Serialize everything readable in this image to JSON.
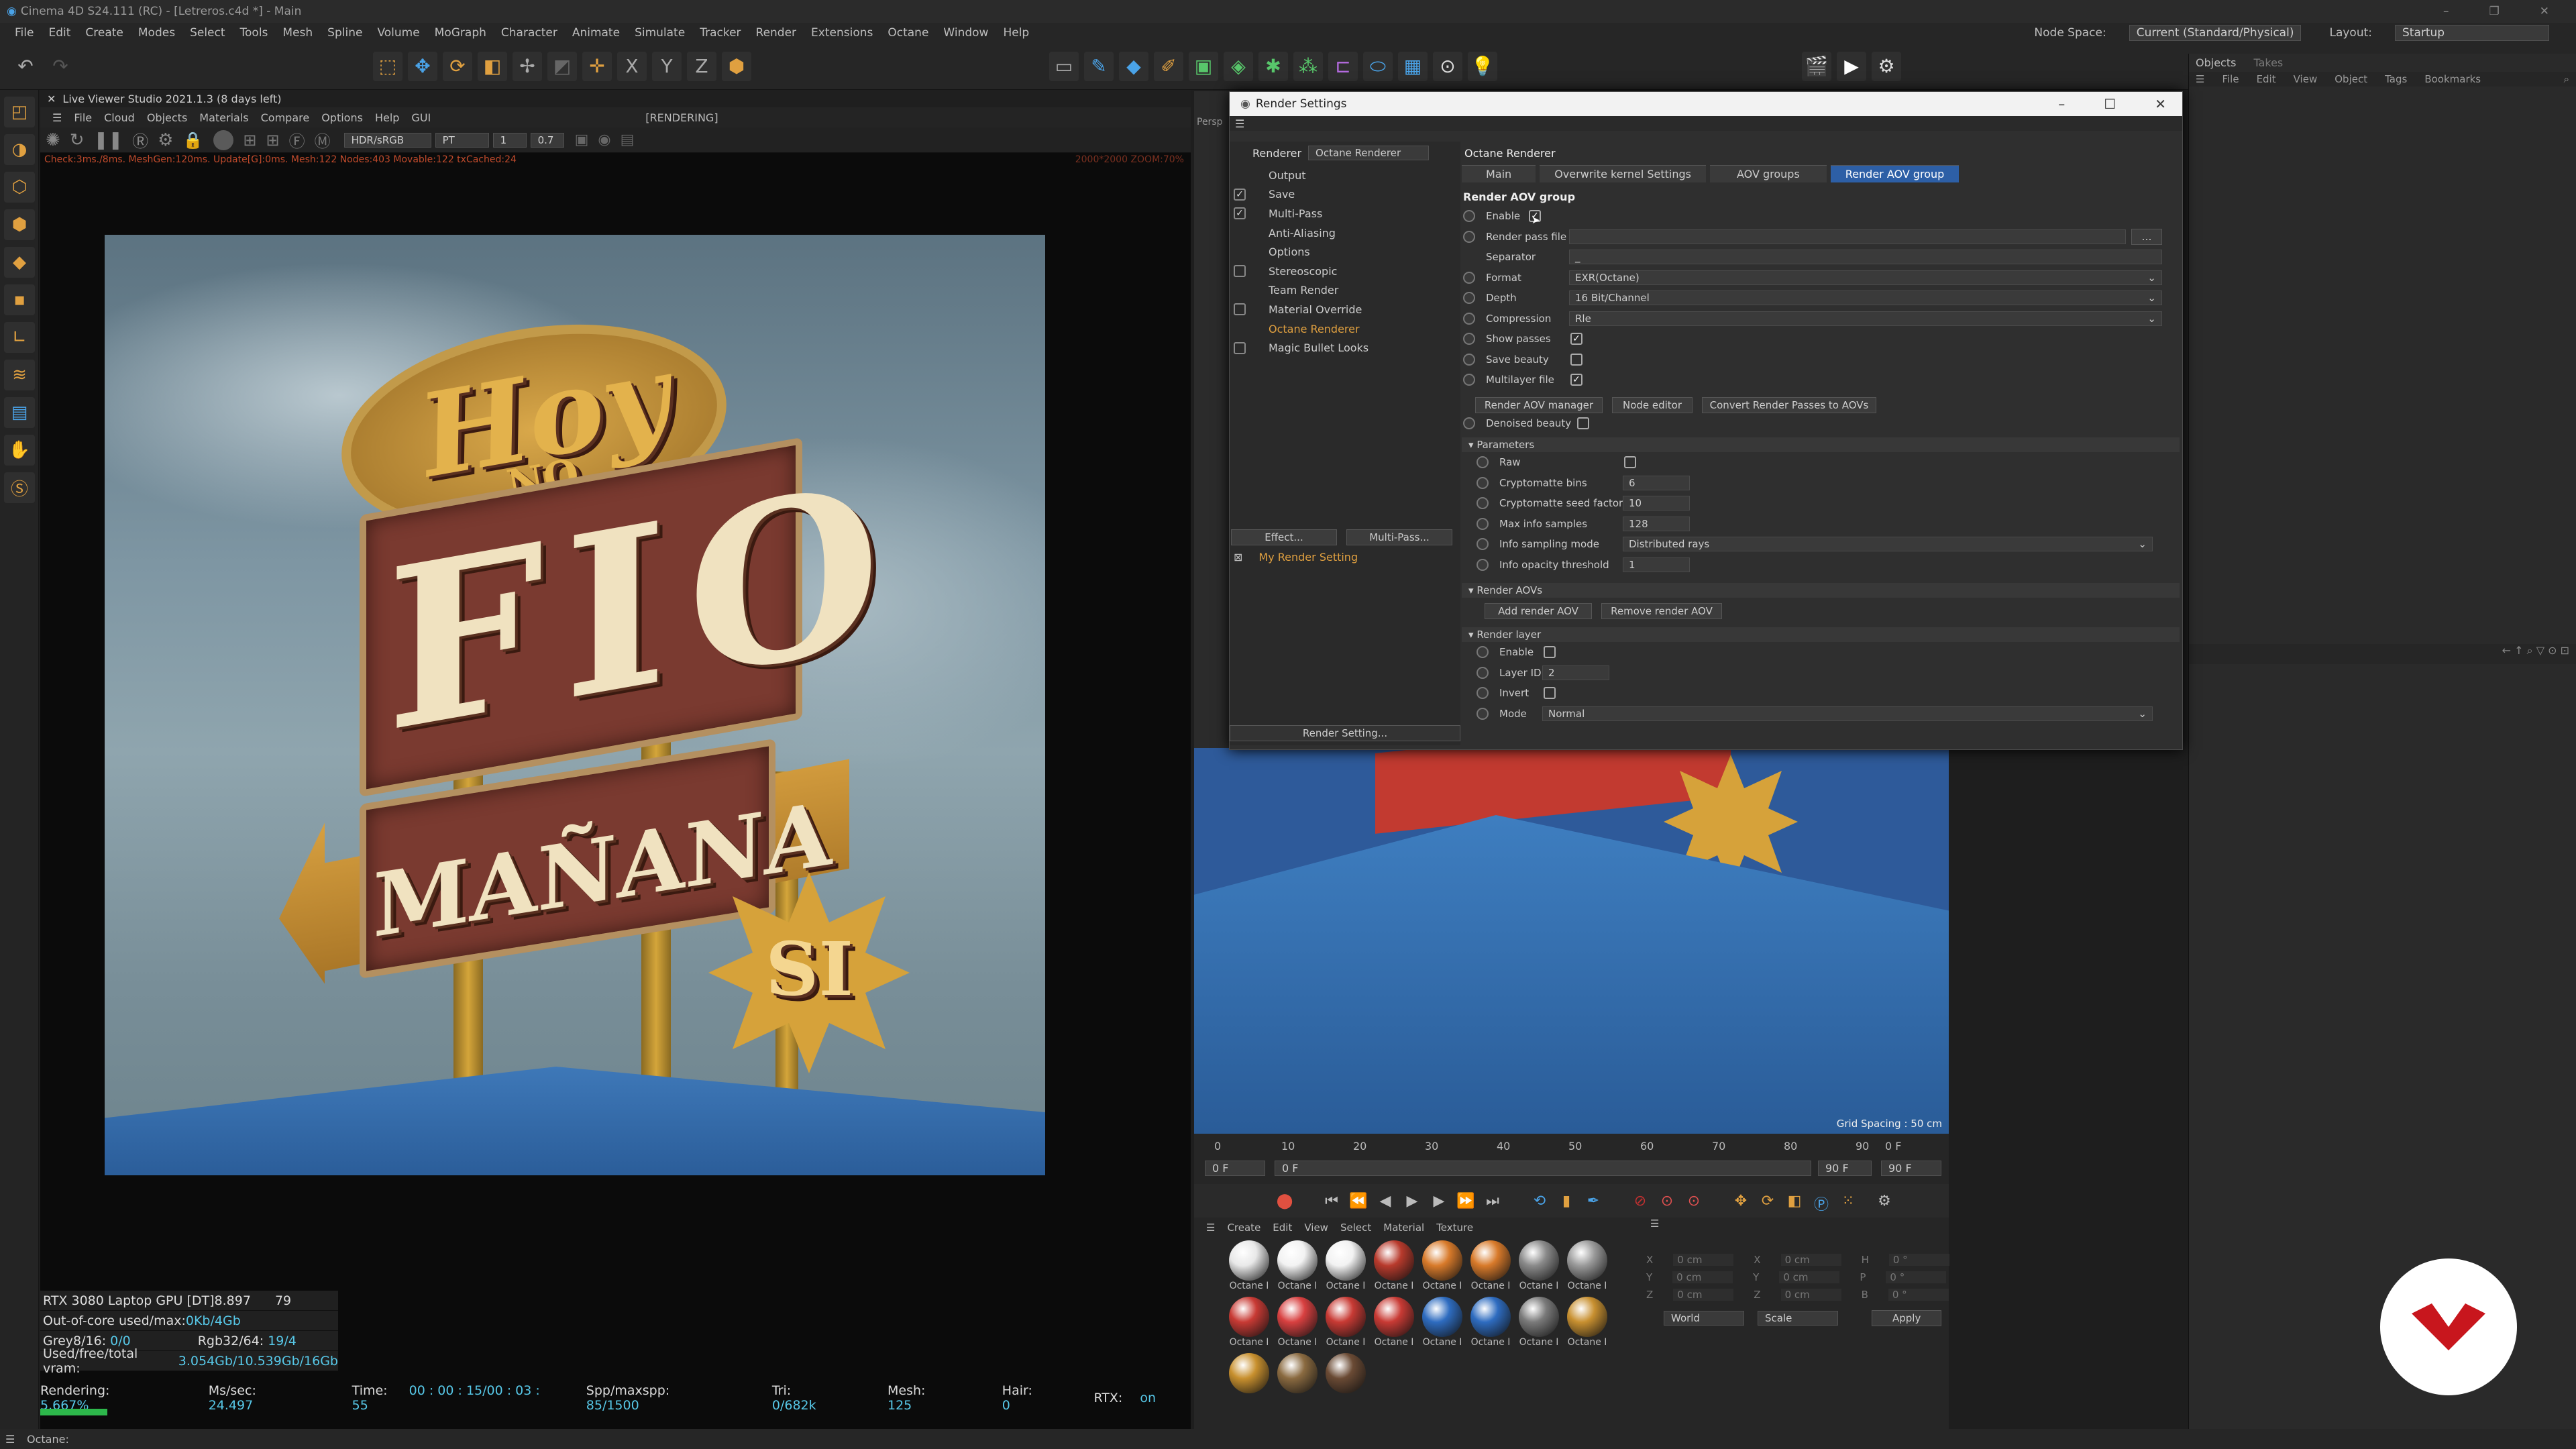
{
  "window": {
    "title": "Cinema 4D S24.111 (RC) - [Letreros.c4d *] - Main"
  },
  "menus": [
    "File",
    "Edit",
    "Create",
    "Modes",
    "Select",
    "Tools",
    "Mesh",
    "Spline",
    "Volume",
    "MoGraph",
    "Character",
    "Animate",
    "Simulate",
    "Tracker",
    "Render",
    "Extensions",
    "Octane",
    "Window",
    "Help"
  ],
  "node_space": {
    "label": "Node Space:",
    "value": "Current (Standard/Physical)"
  },
  "layout": {
    "label": "Layout:",
    "value": "Startup"
  },
  "live_viewer": {
    "title": "Live Viewer Studio 2021.1.3 (8 days left)",
    "menus": [
      "File",
      "Cloud",
      "Objects",
      "Materials",
      "Compare",
      "Options",
      "Help",
      "GUI"
    ],
    "state": "[RENDERING]",
    "color_mode": "HDR/sRGB",
    "kernel": "PT",
    "value1": "1",
    "value2": "0.7",
    "stats_line": "Check:3ms./8ms. MeshGen:120ms. Update[G]:0ms. Mesh:122 Nodes:403 Movable:122 txCached:24",
    "corner_info": "2000*2000 ZOOM:70%"
  },
  "scene_text": {
    "top": "Hoy",
    "no": "NO",
    "middle": "FIO",
    "bottom": "MAÑANA",
    "star": "SI"
  },
  "gpu": {
    "device": "RTX 3080 Laptop GPU [DT]",
    "device_val1": "8.897",
    "device_val2": "79",
    "out_of_core_label": "Out-of-core used/max:",
    "out_of_core_val": "0Kb/4Gb",
    "grey_label": "Grey8/16:",
    "grey_val": "0/0",
    "rgb_label": "Rgb32/64:",
    "rgb_val": "19/4",
    "vram_label": "Used/free/total vram:",
    "vram_val": "3.054Gb/10.539Gb/16Gb"
  },
  "render_status": {
    "rendering_label": "Rendering:",
    "rendering_val": "5.667%",
    "mssec_label": "Ms/sec:",
    "mssec_val": "24.497",
    "time_label": "Time:",
    "time_val": "00 : 00 : 15/00 : 03 : 55",
    "spp_label": "Spp/maxspp:",
    "spp_val": "85/1500",
    "tri_label": "Tri:",
    "tri_val": "0/682k",
    "mesh_label": "Mesh:",
    "mesh_val": "125",
    "hair_label": "Hair:",
    "hair_val": "0",
    "rtx_label": "RTX:",
    "rtx_val": "on",
    "progress": 0.05667
  },
  "status_bar": "Octane:",
  "right_panel": {
    "tabs": [
      "Objects",
      "Takes"
    ],
    "menus": [
      "File",
      "Edit",
      "View",
      "Object",
      "Tags",
      "Bookmarks"
    ]
  },
  "viewport": {
    "label": "Persp",
    "grid": "Grid Spacing : 50 cm"
  },
  "timeline": {
    "ticks": [
      "0",
      "10",
      "20",
      "30",
      "40",
      "50",
      "60",
      "70",
      "80",
      "90"
    ],
    "frame_right": "0 F",
    "start": "0 F",
    "cur": "0 F",
    "end": "90 F",
    "end2": "90 F"
  },
  "materials": {
    "menus": [
      "Create",
      "Edit",
      "View",
      "Select",
      "Material",
      "Texture"
    ],
    "label": "Octane I",
    "rows": [
      [
        {
          "c": "#e8e8e8"
        },
        {
          "c": "#f2f2f2"
        },
        {
          "c": "#f2f2f2"
        },
        {
          "c": "#b83a2c"
        },
        {
          "c": "#d87a2a"
        },
        {
          "c": "#d87a2a"
        },
        {
          "c": "#8a8a8a"
        },
        {
          "c": "#9a9a9a"
        }
      ],
      [
        {
          "c": "#c83a34"
        },
        {
          "c": "#d84040"
        },
        {
          "c": "#c83a34"
        },
        {
          "c": "#c83a34"
        },
        {
          "c": "#2e6cc0"
        },
        {
          "c": "#2e6cc0"
        },
        {
          "c": "#7a7a7a"
        },
        {
          "c": "#c89030"
        }
      ],
      [
        {
          "c": "#c8902e"
        },
        {
          "c": "#8a6a40"
        },
        {
          "c": "#6a4a34"
        }
      ]
    ]
  },
  "coords": {
    "rows": [
      [
        "X",
        "0 cm",
        "X",
        "0 cm",
        "H",
        "0 °"
      ],
      [
        "Y",
        "0 cm",
        "Y",
        "0 cm",
        "P",
        "0 °"
      ],
      [
        "Z",
        "0 cm",
        "Z",
        "0 cm",
        "B",
        "0 °"
      ]
    ],
    "world": "World",
    "scale": "Scale",
    "apply": "Apply"
  },
  "dialog": {
    "title": "Render Settings",
    "renderer_label": "Renderer",
    "renderer_value": "Octane Renderer",
    "tree": [
      {
        "label": "Output",
        "chk": ""
      },
      {
        "label": "Save",
        "chk": "✓"
      },
      {
        "label": "Multi-Pass",
        "chk": "✓"
      },
      {
        "label": "Anti-Aliasing",
        "chk": ""
      },
      {
        "label": "Options",
        "chk": ""
      },
      {
        "label": "Stereoscopic",
        "chk": " "
      },
      {
        "label": "Team Render",
        "chk": ""
      },
      {
        "label": "Material Override",
        "chk": " "
      },
      {
        "label": "Octane Renderer",
        "chk": ""
      },
      {
        "label": "Magic Bullet Looks",
        "chk": " "
      }
    ],
    "effect_btn": "Effect...",
    "multipass_btn": "Multi-Pass...",
    "my_setting": "My Render Setting",
    "render_setting_btn": "Render Setting...",
    "panel_title": "Octane Renderer",
    "tabs": [
      "Main",
      "Overwrite kernel Settings",
      "AOV groups",
      "Render AOV group"
    ],
    "group_title": "Render AOV group",
    "props": {
      "enable": "Enable",
      "render_pass_file": "Render pass file",
      "separator": "Separator",
      "separator_val": "_",
      "format": "Format",
      "format_val": "EXR(Octane)",
      "depth": "Depth",
      "depth_val": "16 Bit/Channel",
      "compression": "Compression",
      "compression_val": "Rle",
      "show_passes": "Show passes",
      "save_beauty": "Save beauty",
      "multilayer": "Multilayer file"
    },
    "buttons": [
      "Render AOV manager",
      "Node editor",
      "Convert Render Passes to AOVs"
    ],
    "denoised": "Denoised beauty",
    "parameters": {
      "title": "Parameters",
      "raw": "Raw",
      "crypto_bins": "Cryptomatte bins",
      "crypto_bins_val": "6",
      "crypto_seed": "Cryptomatte seed factor",
      "crypto_seed_val": "10",
      "max_info": "Max info samples",
      "max_info_val": "128",
      "info_mode": "Info sampling mode",
      "info_mode_val": "Distributed rays",
      "info_opacity": "Info opacity threshold",
      "info_opacity_val": "1"
    },
    "aovs": {
      "title": "Render AOVs",
      "add": "Add render AOV",
      "remove": "Remove render AOV"
    },
    "layer": {
      "title": "Render layer",
      "enable": "Enable",
      "layer_id": "Layer ID",
      "layer_id_val": "2",
      "invert": "Invert",
      "mode": "Mode",
      "mode_val": "Normal"
    }
  }
}
